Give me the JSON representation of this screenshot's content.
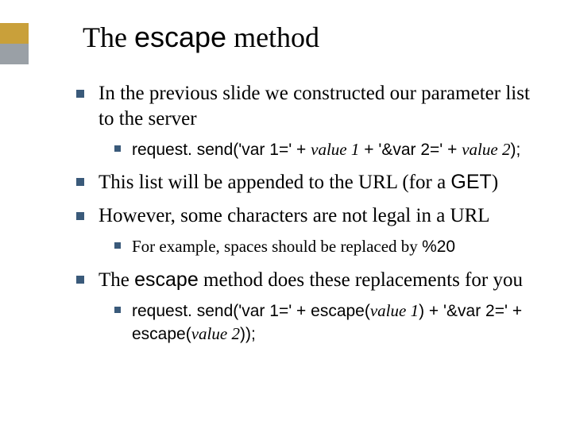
{
  "title": {
    "pre": "The ",
    "code": "escape",
    "post": " method"
  },
  "b1": {
    "text": "In the previous slide we constructed our parameter list to the server",
    "sub": {
      "s1": "request. send('var 1=' + ",
      "s2": "value 1",
      "s3": " + '&var 2=' + ",
      "s4": "value 2",
      "s5": ");"
    }
  },
  "b2": {
    "t1": "This list will be appended to the URL (for a ",
    "t2": "GET",
    "t3": ")"
  },
  "b3": {
    "text": "However, some characters are not legal in a URL",
    "sub": {
      "s1": "For example, spaces should be replaced by ",
      "s2": "%20"
    }
  },
  "b4": {
    "t1": "The ",
    "t2": "escape",
    "t3": " method does these replacements for you",
    "sub": {
      "s1": "request. send('var 1=' + escape(",
      "s2": "value 1",
      "s3": ") + '&var 2=' + escape(",
      "s4": "value 2",
      "s5": "));"
    }
  }
}
